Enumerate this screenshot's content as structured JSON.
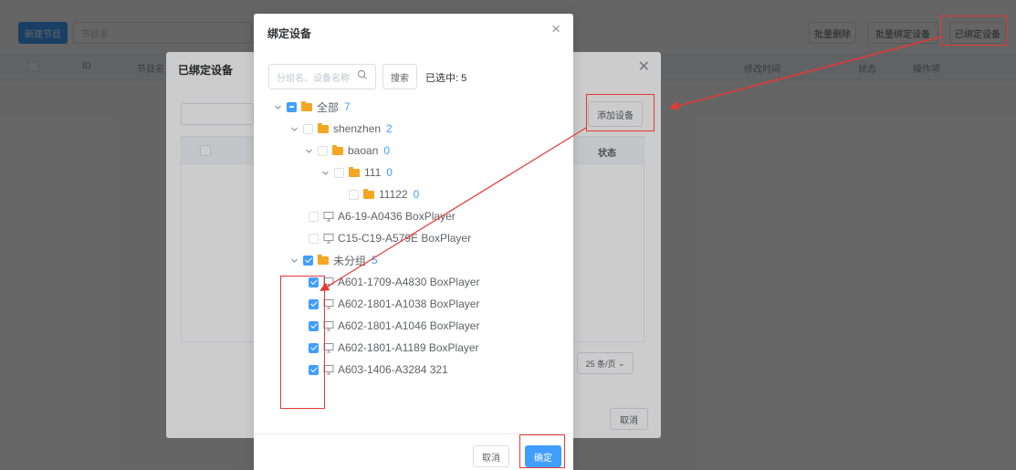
{
  "base": {
    "new_button": "新建节目",
    "search_placeholder": "节目名",
    "right_buttons": [
      "批量删除",
      "批量绑定设备",
      "已绑定设备"
    ],
    "columns": [
      "ID",
      "节目名",
      "",
      "修改时间",
      "状态",
      "操作项"
    ]
  },
  "bound_dialog": {
    "title": "已绑定设备",
    "add_button": "添加设备",
    "status_header": "状态",
    "page_size": "25 条/页",
    "cancel": "取消"
  },
  "bind_dialog": {
    "title": "绑定设备",
    "search_placeholder": "分组名、设备名称",
    "search_button": "搜索",
    "selected_label": "已选中: 5",
    "tree": [
      {
        "label": "全部",
        "count": "7",
        "type": "folder",
        "state": "indet",
        "caret": true
      },
      {
        "label": "shenzhen",
        "count": "2",
        "type": "folder",
        "state": "none",
        "caret": true
      },
      {
        "label": "baoan",
        "count": "0",
        "type": "folder",
        "state": "none",
        "caret": true
      },
      {
        "label": "111",
        "count": "0",
        "type": "folder",
        "state": "none",
        "caret": true
      },
      {
        "label": "11122",
        "count": "0",
        "type": "folder",
        "state": "none",
        "caret": false
      },
      {
        "label": "A6-19-A0436 BoxPlayer",
        "count": "",
        "type": "device",
        "state": "none",
        "caret": false
      },
      {
        "label": "C15-C19-A579E BoxPlayer",
        "count": "",
        "type": "device",
        "state": "none",
        "caret": false
      },
      {
        "label": "未分组",
        "count": "5",
        "type": "folder",
        "state": "checked",
        "caret": true
      },
      {
        "label": "A601-1709-A4830 BoxPlayer",
        "count": "",
        "type": "device",
        "state": "checked",
        "caret": false
      },
      {
        "label": "A602-1801-A1038 BoxPlayer",
        "count": "",
        "type": "device",
        "state": "checked",
        "caret": false
      },
      {
        "label": "A602-1801-A1046 BoxPlayer",
        "count": "",
        "type": "device",
        "state": "checked",
        "caret": false
      },
      {
        "label": "A602-1801-A1189 BoxPlayer",
        "count": "",
        "type": "device",
        "state": "checked",
        "caret": false
      },
      {
        "label": "A603-1406-A3284 321",
        "count": "",
        "type": "device",
        "state": "checked",
        "caret": false
      }
    ],
    "cancel": "取消",
    "confirm": "确定"
  },
  "colors": {
    "primary": "#409eff",
    "folder": "#f5a623",
    "annotation": "#e53935"
  }
}
